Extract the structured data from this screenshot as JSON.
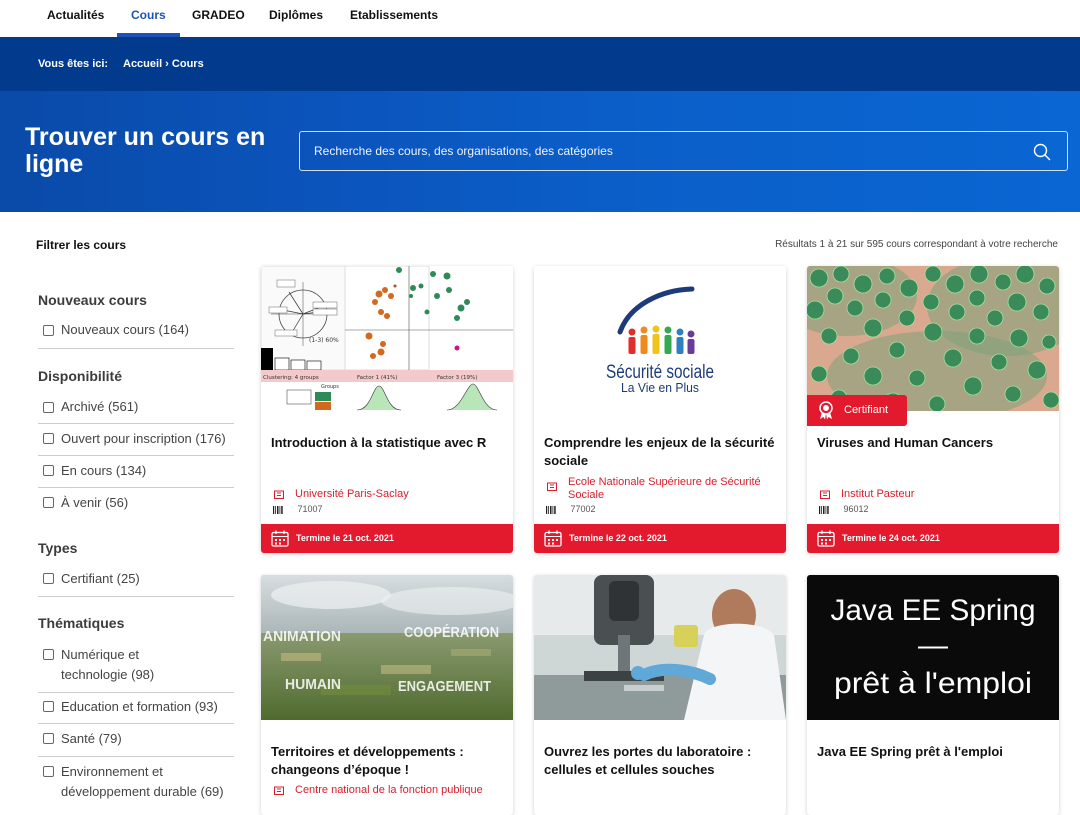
{
  "nav": {
    "items": [
      "Actualités",
      "Cours",
      "GRADEO",
      "Diplômes",
      "Etablissements"
    ],
    "active": "Cours"
  },
  "breadcrumb": {
    "prefix": "Vous êtes ici:",
    "path": "Accueil › Cours"
  },
  "hero": {
    "title": "Trouver un cours en ligne",
    "search_placeholder": "Recherche des cours, des organisations, des catégories"
  },
  "sidebar": {
    "title": "Filtrer les cours",
    "groups": [
      {
        "title": "Nouveaux cours",
        "options": [
          "Nouveaux cours (164)"
        ]
      },
      {
        "title": "Disponibilité",
        "options": [
          "Archivé (561)",
          "Ouvert pour inscription (176)",
          "En cours (134)",
          "À venir (56)"
        ]
      },
      {
        "title": "Types",
        "options": [
          "Certifiant (25)"
        ]
      },
      {
        "title": "Thématiques",
        "options": [
          "Numérique et technologie (98)",
          "Education et formation (93)",
          "Santé (79)",
          "Environnement et développement durable (69)"
        ]
      }
    ]
  },
  "results": {
    "text": "Résultats 1 à 21 sur 595 cours correspondant à votre recherche"
  },
  "cards": [
    {
      "title": "Introduction à la statistique avec R",
      "org": "Université Paris-Saclay",
      "code": "71007",
      "end": "Termine le 21 oct. 2021",
      "badge": "",
      "image": "stats-biplot-chart"
    },
    {
      "title": "Comprendre les enjeux de la sécurité sociale",
      "org": "Ecole Nationale Supérieure de Sécurité Sociale",
      "code": "77002",
      "end": "Termine le 22 oct. 2021",
      "badge": "",
      "image": "securite-sociale-logo"
    },
    {
      "title": "Viruses and Human Cancers",
      "org": "Institut Pasteur",
      "code": "96012",
      "end": "Termine le 24 oct. 2021",
      "badge": "Certifiant",
      "image": "virus-microscopy"
    },
    {
      "title": "Territoires et développements : changeons d’époque !",
      "org": "Centre national de la fonction publique",
      "image": "landscape-words"
    },
    {
      "title": "Ouvrez les portes du laboratoire : cellules et cellules souches",
      "org": "",
      "image": "lab-microscope"
    },
    {
      "title": "Java EE Spring prêt à l'emploi",
      "org": "",
      "image": "java-title"
    }
  ],
  "card_images": {
    "logo_main": "Sécurité sociale",
    "logo_sub": "La Vie en Plus",
    "landscape_words": [
      "ANIMATION",
      "COOPÉRATION",
      "HUMAIN",
      "ENGAGEMENT"
    ],
    "java_lines": [
      "Java EE Spring",
      "—",
      "prêt à l'emploi"
    ],
    "chart_labels": [
      "Clustering: 4 groups",
      "Factor 1 (41%)",
      "Factor 3 (19%)",
      "(1-3) 60%",
      "Groups"
    ]
  },
  "colors": {
    "brand_blue": "#023a8e",
    "nav_active": "#1d54b4",
    "accent_red": "#e3192e"
  }
}
